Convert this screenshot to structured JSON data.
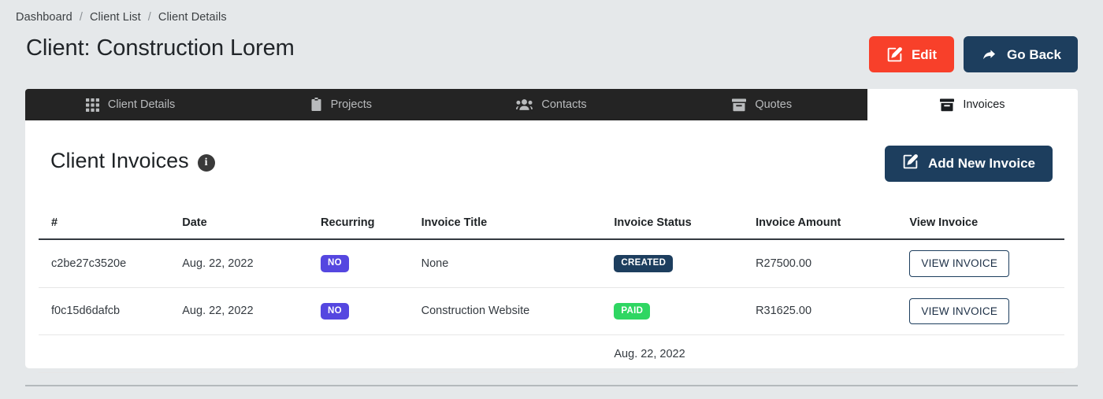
{
  "breadcrumb": {
    "items": [
      {
        "label": "Dashboard"
      },
      {
        "label": "Client List"
      },
      {
        "label": "Client Details"
      }
    ],
    "separator": "/"
  },
  "header": {
    "title": "Client: Construction Lorem",
    "edit_label": "Edit",
    "goback_label": "Go Back",
    "edit_color": "#f8402a",
    "goback_color": "#1d3e5e"
  },
  "tabs": [
    {
      "label": "Client Details",
      "icon": "grid-icon",
      "active": false
    },
    {
      "label": "Projects",
      "icon": "clipboard-icon",
      "active": false
    },
    {
      "label": "Contacts",
      "icon": "users-icon",
      "active": false
    },
    {
      "label": "Quotes",
      "icon": "archive-icon",
      "active": false
    },
    {
      "label": "Invoices",
      "icon": "archive-icon",
      "active": true
    }
  ],
  "panel": {
    "title": "Client Invoices",
    "info_glyph": "i",
    "add_button_label": "Add New Invoice"
  },
  "table": {
    "headers": [
      "#",
      "Date",
      "Recurring",
      "Invoice Title",
      "Invoice Status",
      "Invoice Amount",
      "View Invoice"
    ],
    "rows": [
      {
        "id": "c2be27c3520e",
        "date": "Aug. 22, 2022",
        "recurring": "NO",
        "invoice_title": "None",
        "status": "CREATED",
        "status_color": "#1d3e5e",
        "amount": "R27500.00",
        "view_label": "VIEW INVOICE"
      },
      {
        "id": "f0c15d6dafcb",
        "date": "Aug. 22, 2022",
        "recurring": "NO",
        "invoice_title": "Construction Website",
        "status": "PAID",
        "status_color": "#2fd662",
        "amount": "R31625.00",
        "view_label": "VIEW INVOICE"
      }
    ],
    "trailing_row": {
      "status": "Aug. 22, 2022"
    }
  }
}
